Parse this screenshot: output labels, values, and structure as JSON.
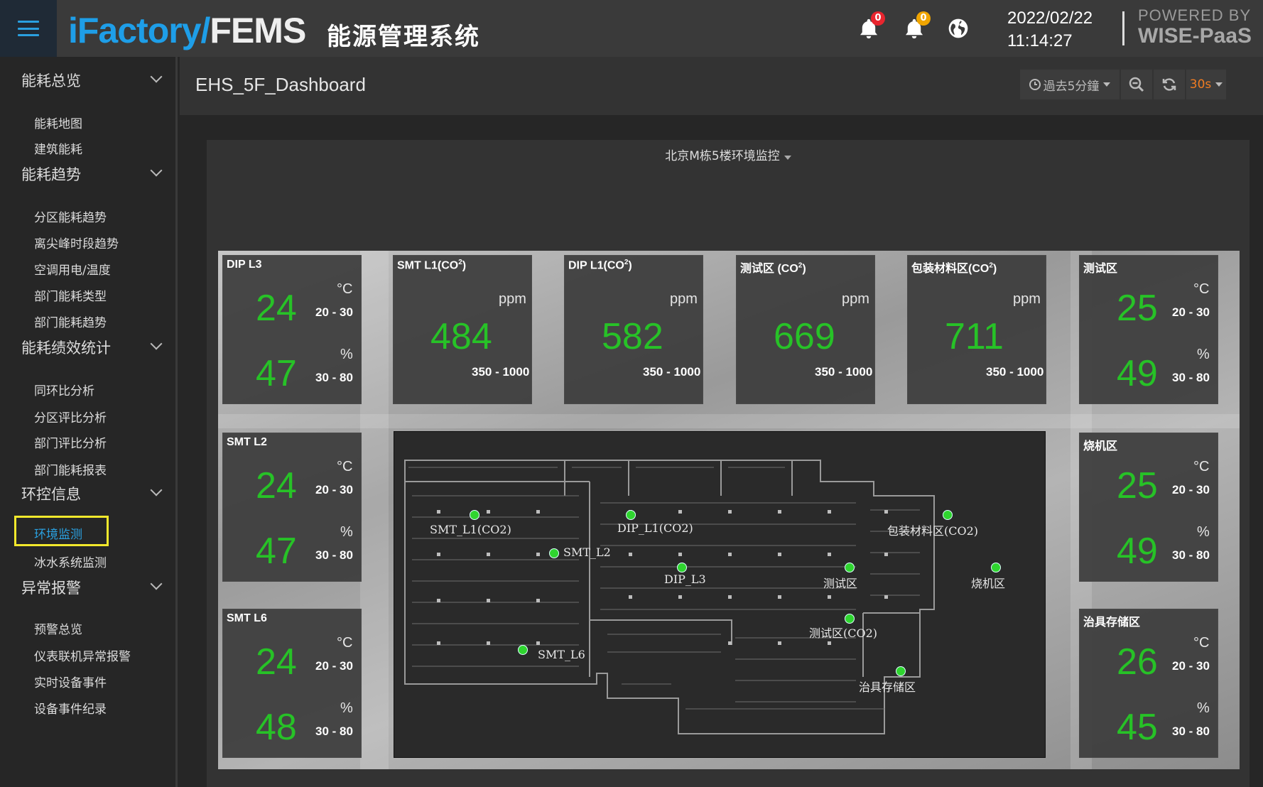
{
  "header": {
    "brand_part1": "iFactory/",
    "brand_part2": "FEMS",
    "subtitle": "能源管理系统",
    "alerts": [
      {
        "count": "0",
        "color": "#e8252e"
      },
      {
        "count": "0",
        "color": "#f0a500"
      }
    ],
    "date": "2022/02/22",
    "time": "11:14:27",
    "powered_line1": "POWERED BY",
    "powered_line2": "WISE-PaaS"
  },
  "sidebar": {
    "groups": [
      {
        "title": "能耗总览",
        "items": [
          "能耗地图",
          "建筑能耗"
        ]
      },
      {
        "title": "能耗趋势",
        "items": [
          "分区能耗趋势",
          "离尖峰时段趋势",
          "空调用电/温度",
          "部门能耗类型",
          "部门能耗趋势"
        ]
      },
      {
        "title": "能耗绩效统计",
        "items": [
          "同环比分析",
          "分区评比分析",
          "部门评比分析",
          "部门能耗报表"
        ]
      },
      {
        "title": "环控信息",
        "items": [
          "环境监测",
          "冰水系统监测"
        ]
      },
      {
        "title": "异常报警",
        "items": [
          "预警总览",
          "仪表联机异常报警",
          "实时设备事件",
          "设备事件纪录"
        ]
      }
    ],
    "active_item": "环境监测"
  },
  "dashboard": {
    "title": "EHS_5F_Dashboard",
    "time_range": "過去5分鐘",
    "refresh_interval": "30s"
  },
  "panel": {
    "title": "北京M栋5楼环境监控"
  },
  "cards": {
    "dip_l3": {
      "name": "DIP L3",
      "temp": "24",
      "temp_unit": "°C",
      "temp_range": "20 - 30",
      "hum": "47",
      "hum_unit": "%",
      "hum_range": "30 - 80"
    },
    "smt_l2": {
      "name": "SMT L2",
      "temp": "24",
      "temp_unit": "°C",
      "temp_range": "20 - 30",
      "hum": "47",
      "hum_unit": "%",
      "hum_range": "30 - 80"
    },
    "smt_l6": {
      "name": "SMT L6",
      "temp": "24",
      "temp_unit": "°C",
      "temp_range": "20 - 30",
      "hum": "48",
      "hum_unit": "%",
      "hum_range": "30 - 80"
    },
    "test_area": {
      "name": "测试区",
      "temp": "25",
      "temp_unit": "°C",
      "temp_range": "20 - 30",
      "hum": "49",
      "hum_unit": "%",
      "hum_range": "30 - 80"
    },
    "burn_area": {
      "name": "烧机区",
      "temp": "25",
      "temp_unit": "°C",
      "temp_range": "20 - 30",
      "hum": "49",
      "hum_unit": "%",
      "hum_range": "30 - 80"
    },
    "fixture_area": {
      "name": "治具存储区",
      "temp": "26",
      "temp_unit": "°C",
      "temp_range": "20 - 30",
      "hum": "45",
      "hum_unit": "%",
      "hum_range": "30 - 80"
    },
    "smt_l1_co2": {
      "name": "SMT L1(CO",
      "sup": "2",
      "close": ")",
      "value": "484",
      "unit": "ppm",
      "range": "350 - 1000"
    },
    "dip_l1_co2": {
      "name": "DIP L1(CO",
      "sup": "2",
      "close": ")",
      "value": "582",
      "unit": "ppm",
      "range": "350 - 1000"
    },
    "test_co2": {
      "name": "测试区 (CO",
      "sup": "2",
      "close": ")",
      "value": "669",
      "unit": "ppm",
      "range": "350 - 1000"
    },
    "pack_co2": {
      "name": "包装材料区(CO",
      "sup": "2",
      "close": ")",
      "value": "711",
      "unit": "ppm",
      "range": "350 - 1000"
    }
  },
  "floorplan_labels": {
    "smt_l1": "SMT_L1(CO2)",
    "smt_l2": "SMT_L2",
    "smt_l6": "SMT_L6",
    "dip_l1": "DIP_L1(CO2)",
    "dip_l3": "DIP_L3",
    "pack": "包装材料区(CO2)",
    "test": "测试区",
    "burn": "烧机区",
    "test_co2": "测试区(CO2)",
    "fixture": "治具存储区"
  }
}
